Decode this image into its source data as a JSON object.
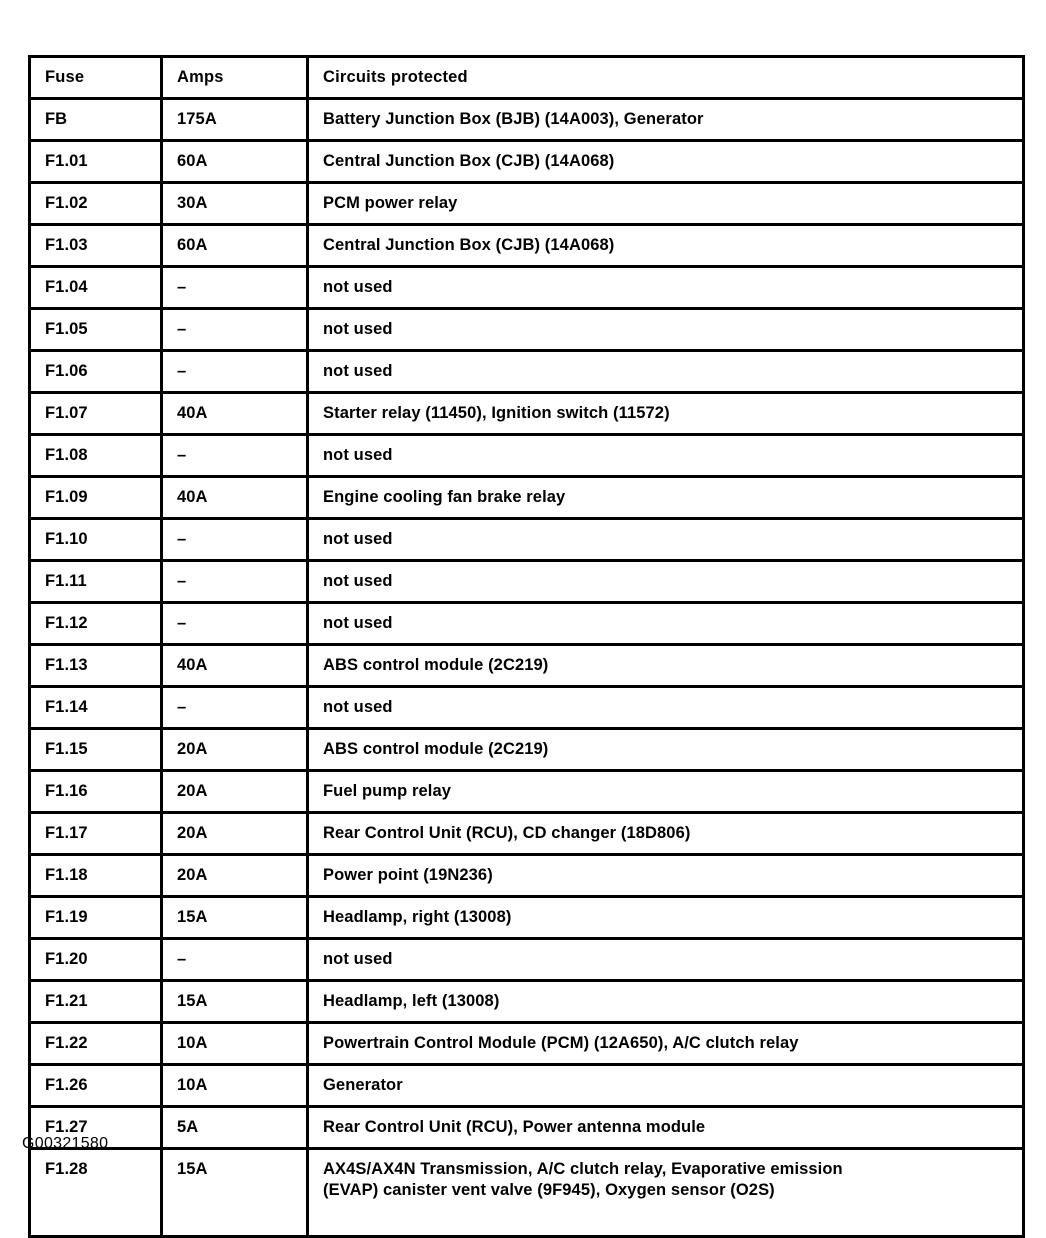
{
  "document": {
    "caption": "G00321580",
    "ink_color": "#000000",
    "page_color": "#ffffff"
  },
  "table": {
    "name": "fuse-box-table",
    "columns": [
      {
        "key": "fuse",
        "header": "Fuse"
      },
      {
        "key": "amps",
        "header": "Amps"
      },
      {
        "key": "circuit",
        "header": "Circuits protected"
      }
    ],
    "headers": {
      "fuse": "Fuse",
      "amps": "Amps",
      "circuit": "Circuits protected"
    },
    "rows": [
      {
        "fuse": "FB",
        "amps": "175A",
        "circuit": "Battery Junction Box (BJB) (14A003), Generator"
      },
      {
        "fuse": "F1.01",
        "amps": "60A",
        "circuit": "Central Junction Box (CJB) (14A068)"
      },
      {
        "fuse": "F1.02",
        "amps": "30A",
        "circuit": "PCM power relay"
      },
      {
        "fuse": "F1.03",
        "amps": "60A",
        "circuit": "Central Junction Box (CJB) (14A068)"
      },
      {
        "fuse": "F1.04",
        "amps": "–",
        "circuit": "not used"
      },
      {
        "fuse": "F1.05",
        "amps": "–",
        "circuit": "not used"
      },
      {
        "fuse": "F1.06",
        "amps": "–",
        "circuit": "not used"
      },
      {
        "fuse": "F1.07",
        "amps": "40A",
        "circuit": "Starter relay (11450), Ignition switch (11572)"
      },
      {
        "fuse": "F1.08",
        "amps": "–",
        "circuit": "not used"
      },
      {
        "fuse": "F1.09",
        "amps": "40A",
        "circuit": "Engine cooling fan brake relay"
      },
      {
        "fuse": "F1.10",
        "amps": "–",
        "circuit": "not used"
      },
      {
        "fuse": "F1.11",
        "amps": "–",
        "circuit": "not used"
      },
      {
        "fuse": "F1.12",
        "amps": "–",
        "circuit": "not used"
      },
      {
        "fuse": "F1.13",
        "amps": "40A",
        "circuit": "ABS control module (2C219)"
      },
      {
        "fuse": "F1.14",
        "amps": "–",
        "circuit": "not used"
      },
      {
        "fuse": "F1.15",
        "amps": "20A",
        "circuit": "ABS control module (2C219)"
      },
      {
        "fuse": "F1.16",
        "amps": "20A",
        "circuit": "Fuel pump relay"
      },
      {
        "fuse": "F1.17",
        "amps": "20A",
        "circuit": "Rear Control Unit (RCU), CD changer (18D806)"
      },
      {
        "fuse": "F1.18",
        "amps": "20A",
        "circuit": "Power point (19N236)"
      },
      {
        "fuse": "F1.19",
        "amps": "15A",
        "circuit": "Headlamp, right (13008)"
      },
      {
        "fuse": "F1.20",
        "amps": "–",
        "circuit": "not used"
      },
      {
        "fuse": "F1.21",
        "amps": "15A",
        "circuit": "Headlamp, left (13008)"
      },
      {
        "fuse": "F1.22",
        "amps": "10A",
        "circuit": "Powertrain Control Module (PCM) (12A650), A/C clutch relay"
      },
      {
        "fuse": "F1.26",
        "amps": "10A",
        "circuit": "Generator"
      },
      {
        "fuse": "F1.27",
        "amps": "5A",
        "circuit": "Rear Control Unit (RCU), Power antenna module"
      },
      {
        "fuse": "F1.28",
        "amps": "15A",
        "circuit": "AX4S/AX4N Transmission, A/C clutch relay, Evaporative emission (EVAP) canister vent valve (9F945), Oxygen sensor (O2S)",
        "circuit_line1": "AX4S/AX4N Transmission, A/C clutch relay, Evaporative emission",
        "circuit_line2": "(EVAP) canister vent valve (9F945), Oxygen sensor (O2S)",
        "tall": true
      }
    ]
  }
}
